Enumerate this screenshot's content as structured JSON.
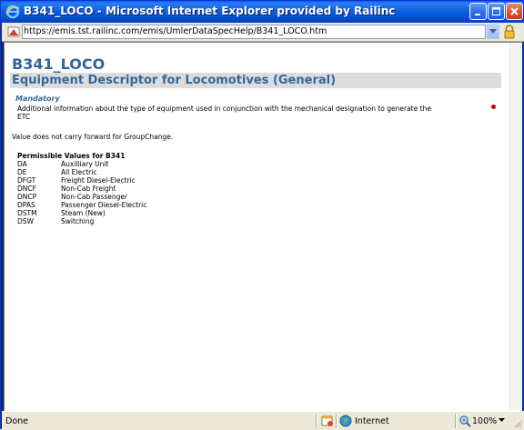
{
  "window": {
    "title": "B341_LOCO - Microsoft Internet Explorer provided by Railinc"
  },
  "address_bar": {
    "url": "https://emis.tst.railinc.com/emis/UmlerDataSpecHelp/B341_LOCO.htm"
  },
  "content": {
    "page_heading": "B341_LOCO",
    "section_title": "Equipment Descriptor for Locomotives (General)",
    "mandatory_label": "Mandatory",
    "description": "Additional information about the type of equipment used in conjunction with the mechanical designation to generate the ETC",
    "carry_forward_note": "Value does not carry forward for  GroupChange.",
    "permissible_values": {
      "header": "Permissible Values for B341",
      "rows": [
        {
          "code": "DA",
          "label": "Auxilliary Unit"
        },
        {
          "code": "DE",
          "label": "All Electric"
        },
        {
          "code": "DFGT",
          "label": "Freight Diesel-Electric"
        },
        {
          "code": "DNCF",
          "label": "Non-Cab Freight"
        },
        {
          "code": "DNCP",
          "label": "Non-Cab Passenger"
        },
        {
          "code": "DPAS",
          "label": "Passenger Diesel-Electric"
        },
        {
          "code": "DSTM",
          "label": "Steam (New)"
        },
        {
          "code": "DSW",
          "label": "Switching"
        }
      ]
    }
  },
  "status_bar": {
    "status": "Done",
    "zone": "Internet",
    "zoom": "100%"
  },
  "colors": {
    "heading": "#336699",
    "band": "#dcdcdc",
    "required_dot": "#cc0000"
  }
}
